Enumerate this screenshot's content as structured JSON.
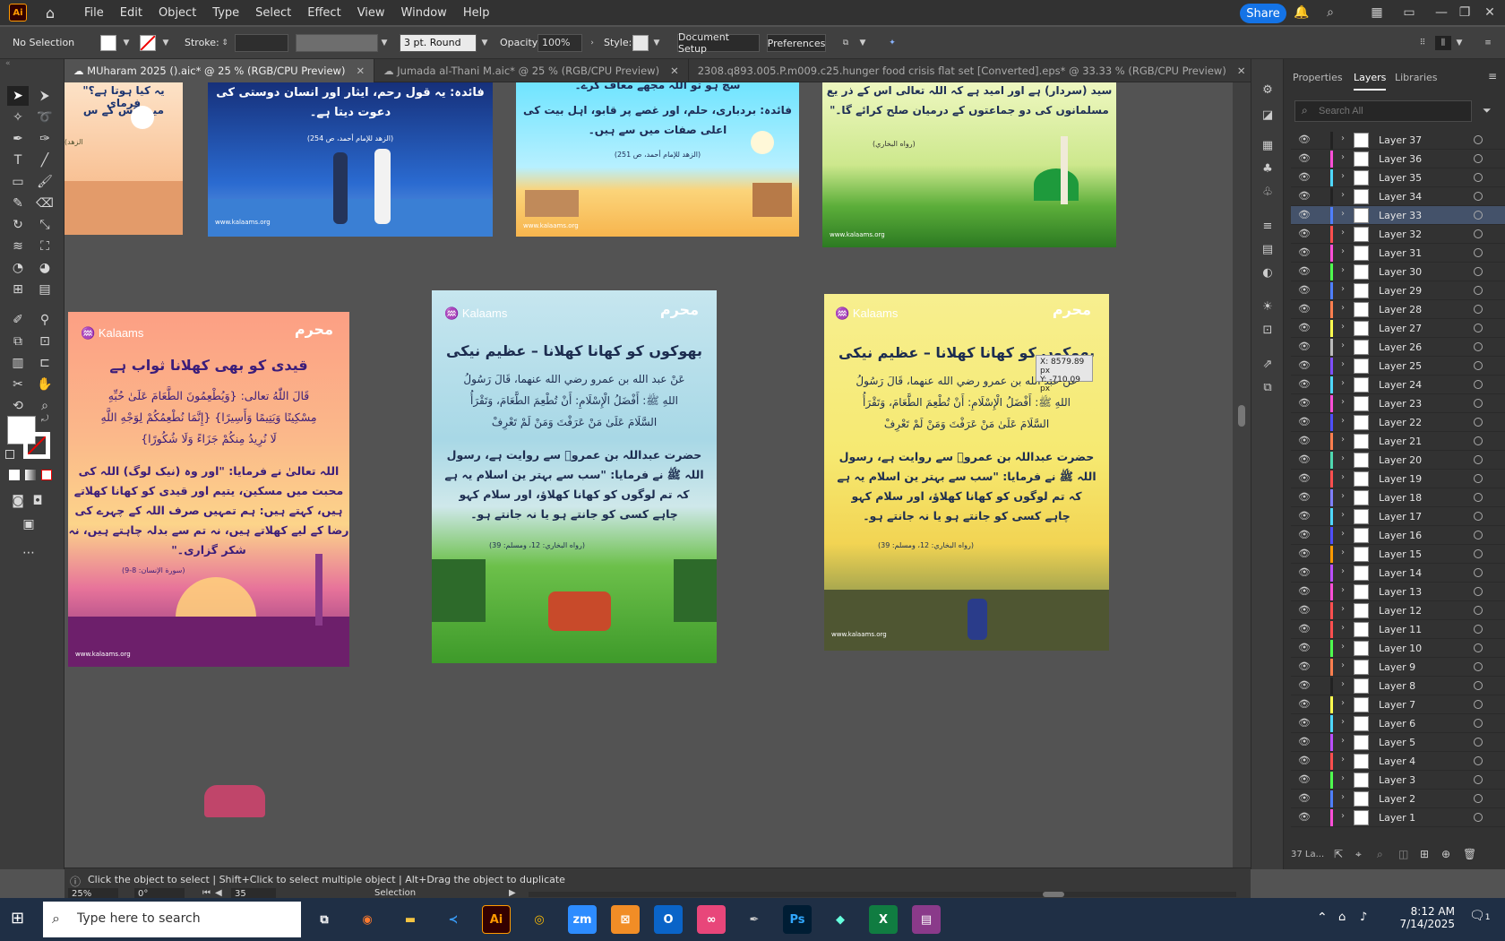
{
  "app": {
    "logo": "Ai"
  },
  "menu": [
    "File",
    "Edit",
    "Object",
    "Type",
    "Select",
    "Effect",
    "View",
    "Window",
    "Help"
  ],
  "share_label": "Share",
  "control": {
    "selection": "No Selection",
    "stroke_label": "Stroke:",
    "brush": "3 pt. Round",
    "opacity_label": "Opacity:",
    "opacity_value": "100%",
    "style_label": "Style:",
    "doc_setup": "Document Setup",
    "preferences": "Preferences"
  },
  "tabs": [
    {
      "label": "MUharam 2025 ().aic* @ 25 % (RGB/CPU Preview)",
      "active": true
    },
    {
      "label": "Jumada al-Thani M.aic* @ 25 % (RGB/CPU Preview)",
      "active": false
    },
    {
      "label": "2308.q893.005.P.m009.c25.hunger food crisis flat set [Converted].eps* @ 33.33 % (RGB/CPU Preview)",
      "active": false
    }
  ],
  "panel": {
    "tabs": [
      "Properties",
      "Layers",
      "Libraries"
    ],
    "search_placeholder": "Search All",
    "layers_count": "37 La...",
    "layers": [
      {
        "name": "Layer 37",
        "color": "#222222"
      },
      {
        "name": "Layer 36",
        "color": "#ff4fd8"
      },
      {
        "name": "Layer 35",
        "color": "#4fd8ff"
      },
      {
        "name": "Layer 34",
        "color": "#222222"
      },
      {
        "name": "Layer 33",
        "color": "#4f7fff"
      },
      {
        "name": "Layer 32",
        "color": "#ff4f4f"
      },
      {
        "name": "Layer 31",
        "color": "#ff4fd8"
      },
      {
        "name": "Layer 30",
        "color": "#4fff4f"
      },
      {
        "name": "Layer 29",
        "color": "#4f7fff"
      },
      {
        "name": "Layer 28",
        "color": "#ff7f4f"
      },
      {
        "name": "Layer 27",
        "color": "#ffff4f"
      },
      {
        "name": "Layer 26",
        "color": "#bbbbbb"
      },
      {
        "name": "Layer 25",
        "color": "#7f4fff"
      },
      {
        "name": "Layer 24",
        "color": "#4fd8ff"
      },
      {
        "name": "Layer 23",
        "color": "#ff4fd8"
      },
      {
        "name": "Layer 22",
        "color": "#4f4fff"
      },
      {
        "name": "Layer 21",
        "color": "#ff7f4f"
      },
      {
        "name": "Layer 20",
        "color": "#4fd8b0"
      },
      {
        "name": "Layer 19",
        "color": "#ff4f4f"
      },
      {
        "name": "Layer 18",
        "color": "#7f7fff"
      },
      {
        "name": "Layer 17",
        "color": "#4fd8ff"
      },
      {
        "name": "Layer 16",
        "color": "#4f4fff"
      },
      {
        "name": "Layer 15",
        "color": "#ff9a00"
      },
      {
        "name": "Layer 14",
        "color": "#bb4fff"
      },
      {
        "name": "Layer 13",
        "color": "#ff4fd8"
      },
      {
        "name": "Layer 12",
        "color": "#ff4f4f"
      },
      {
        "name": "Layer 11",
        "color": "#ff4f4f"
      },
      {
        "name": "Layer 10",
        "color": "#4fff4f"
      },
      {
        "name": "Layer 9",
        "color": "#ff7f4f"
      },
      {
        "name": "Layer 8",
        "color": "#222222"
      },
      {
        "name": "Layer 7",
        "color": "#ffff4f"
      },
      {
        "name": "Layer 6",
        "color": "#4fd8ff"
      },
      {
        "name": "Layer 5",
        "color": "#bb4fff"
      },
      {
        "name": "Layer 4",
        "color": "#ff4f4f"
      },
      {
        "name": "Layer 3",
        "color": "#4fff4f"
      },
      {
        "name": "Layer 2",
        "color": "#4f7fff"
      },
      {
        "name": "Layer 1",
        "color": "#ff4fd8"
      }
    ]
  },
  "artboards": {
    "a1": {
      "text1": "یہ کیا ہوتا ہے؟\" فرمای",
      "text2": "میں کس کے س",
      "ref": "(الزهد"
    },
    "a2": {
      "title": "فائدہ: یہ قول رحم، ایثار اور انسان دوستی کی",
      "title2": "دعوت دیتا ہے۔",
      "ref": "(الزهد للإمام أحمد، ص 254)",
      "site": "www.kalaams.org"
    },
    "a3": {
      "top": "سچ ہو تو اللہ مجھے معاف کرے۔",
      "line1": "فائدہ: بردباری، حلم، اور غصے پر قابو، اہل بیت کی",
      "line2": "اعلی صفات میں سے ہیں۔",
      "ref": "(الزهد للإمام أحمد، ص 251)",
      "site": "www.kalaams.org"
    },
    "a4": {
      "line1": "سید (سردار) ہے اور امید ہے کہ اللہ تعالی اس کے ذر یع",
      "line2": "مسلمانوں کی دو جماعتوں کے درمیان صلح کرائے گا۔\"",
      "ref": "(رواه البخاري)",
      "site": "www.kalaams.org"
    },
    "a5": {
      "logo": "Kalaams",
      "badge": "محرم",
      "title": "قیدی کو بھی کھلانا ثواب ہے",
      "ar1": "قَالَ اللّٰهُ تعالى: {وَيُطْعِمُونَ الطَّعَامَ عَلَىٰ حُبِّهِ",
      "ar2": "مِسْكِينًا وَيَتِيمًا وَأَسِيرًا} {إِنَّمَا نُطْعِمُكُمْ لِوَجْهِ اللَّهِ",
      "ar3": "لَا نُرِيدُ مِنكُمْ جَزَاءً وَلَا شُكُورًا}",
      "ur1": "اللہ تعالیٰ نے فرمایا: \"اور وہ (نیک لوگ) اللہ کی",
      "ur2": "محبت میں مسکین، یتیم اور قیدی کو کھانا کھلاتے",
      "ur3": "ہیں، کہتے ہیں: ہم تمہیں صرف اللہ کے چہرے کی",
      "ur4": "رضا کے لیے کھلاتے ہیں، نہ تم سے بدلہ چاہتے ہیں، نہ",
      "ur5": "شکر گزاری۔\"",
      "ref": "(سورة الإنسان: 8-9)",
      "site": "www.kalaams.org"
    },
    "a6": {
      "logo": "Kalaams",
      "badge": "محرم",
      "title": "بھوکوں کو کھانا کھلانا – عظیم نیکی",
      "ar1": "عَنْ عبد الله بن عمرو رضي الله عنهما، قَالَ رَسُولُ",
      "ar2": "اللهِ ﷺ: أَفْضَلُ الْإِسْلَامِ: أَنْ تُطْعِمَ الطَّعَامَ، وَتَقْرَأُ",
      "ar3": "السَّلَامَ عَلَىٰ مَنْ عَرَفْتَ وَمَنْ لَمْ تَعْرِفْ",
      "ur1": "حضرت عبداللہ بن عمروؓ سے روایت ہے، رسول",
      "ur2": "اللہ ﷺ نے فرمایا: \"سب سے بہتر ین اسلام یہ ہے",
      "ur3": "کہ تم لوگوں کو کھانا کھلاؤ، اور سلام کہو",
      "ur4": "چاہے کسی کو جانتے ہو یا نہ جانتے ہو۔",
      "ref": "(رواه البخاري: 12، ومسلم: 39)"
    },
    "a7": {
      "logo": "Kalaams",
      "badge": "محرم",
      "title": "بھوکوں کو کھانا کھلانا – عظیم نیکی",
      "ar1": "عَنْ عبد الله بن عمرو رضي الله عنهما، قَالَ رَسُولُ",
      "ar2": "اللهِ ﷺ: أَفْضَلُ الْإِسْلَامِ: أَنْ تُطْعِمَ الطَّعَامَ، وَتَقْرَأُ",
      "ar3": "السَّلَامَ عَلَىٰ مَنْ عَرَفْتَ وَمَنْ لَمْ تَعْرِفْ",
      "ur1": "حضرت عبداللہ بن عمروؓ سے روایت ہے، رسول",
      "ur2": "اللہ ﷺ نے فرمایا: \"سب سے بہتر ین اسلام یہ ہے",
      "ur3": "کہ تم لوگوں کو کھانا کھلاؤ، اور سلام کہو",
      "ur4": "چاہے کسی کو جانتے ہو یا نہ جانتے ہو۔",
      "ref": "(رواه البخاري: 12، ومسلم: 39)",
      "site": "www.kalaams.org"
    }
  },
  "tooltip": {
    "x": "X: 8579.89 px",
    "y": "Y: -710.09 px"
  },
  "status": {
    "hint": "Click the object to select  |  Shift+Click to select multiple object  |  Alt+Drag the object to duplicate",
    "zoom": "25%",
    "rotation": "0°",
    "artboard": "35",
    "tool": "Selection"
  },
  "taskbar": {
    "search_placeholder": "Type here to search",
    "time": "8:12 AM",
    "date": "7/14/2025",
    "notifications": "1"
  }
}
